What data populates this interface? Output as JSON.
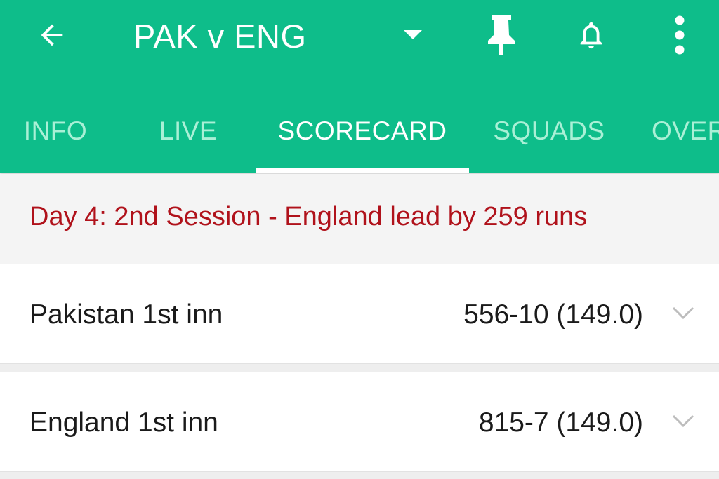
{
  "header": {
    "title": "PAK v ENG",
    "background_color": "#0ebd8a",
    "icons": [
      "arrow-left-icon",
      "caret-down-icon",
      "pin-icon",
      "bell-icon",
      "more-vert-icon"
    ]
  },
  "tabs": [
    {
      "label": "INFO",
      "active": false
    },
    {
      "label": "LIVE",
      "active": false
    },
    {
      "label": "SCORECARD",
      "active": true
    },
    {
      "label": "SQUADS",
      "active": false
    },
    {
      "label": "OVER",
      "active": false
    }
  ],
  "status": {
    "text": "Day 4: 2nd Session - England lead by 259 runs",
    "color": "#b0121b"
  },
  "innings": [
    {
      "name": "Pakistan 1st inn",
      "score": "556-10 (149.0)"
    },
    {
      "name": "England 1st inn",
      "score": "815-7 (149.0)"
    }
  ]
}
